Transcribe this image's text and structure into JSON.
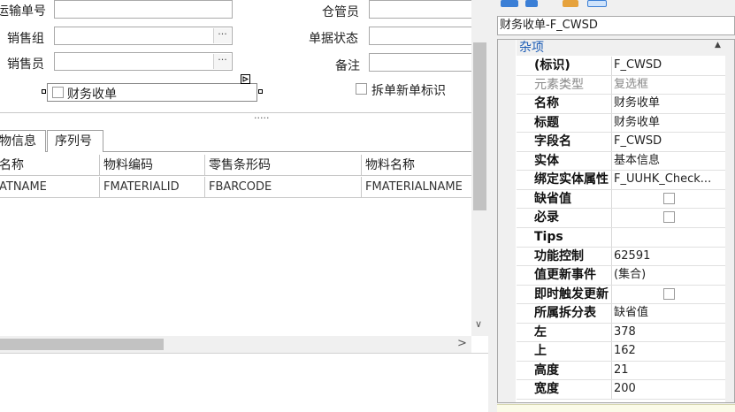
{
  "form": {
    "fields": [
      {
        "label": "运输单号",
        "value": ""
      },
      {
        "label": "销售组",
        "value": "",
        "button": "···"
      },
      {
        "label": "销售员",
        "value": "",
        "button": "···"
      },
      {
        "label": "仓管员",
        "value": ""
      },
      {
        "label": "单据状态",
        "value": ""
      },
      {
        "label": "备注",
        "value": ""
      }
    ],
    "selected_checkbox": {
      "label": "财务收单"
    },
    "split_checkbox": {
      "label": "拆单新单标识"
    },
    "splitter": "·····"
  },
  "tabs": [
    {
      "label": "物信息"
    },
    {
      "label": "序列号"
    }
  ],
  "table": {
    "headers": [
      "名称",
      "物料编码",
      "零售条形码",
      "物料名称"
    ],
    "rows": [
      [
        "ATNAME",
        "FMATERIALID",
        "FBARCODE",
        "FMATERIALNAME"
      ]
    ]
  },
  "scroll_arrows": {
    "down": "∨",
    "right": ">"
  },
  "properties": {
    "object_selector": "财务收单-F_CWSD",
    "category": "杂项",
    "collapse_glyph": "▲",
    "rows": [
      {
        "name": "(标识)",
        "value": "F_CWSD"
      },
      {
        "name": "元素类型",
        "value": "复选框",
        "disabled": true
      },
      {
        "name": "名称",
        "value": "财务收单"
      },
      {
        "name": "标题",
        "value": "财务收单"
      },
      {
        "name": "字段名",
        "value": "F_CWSD"
      },
      {
        "name": "实体",
        "value": "基本信息"
      },
      {
        "name": "绑定实体属性",
        "value": "F_UUHK_Check..."
      },
      {
        "name": "缺省值",
        "value": "",
        "checkbox": true
      },
      {
        "name": "必录",
        "value": "",
        "checkbox": true
      },
      {
        "name": "Tips",
        "value": ""
      },
      {
        "name": "功能控制",
        "value": "62591"
      },
      {
        "name": "值更新事件",
        "value": "(集合)"
      },
      {
        "name": "即时触发更新",
        "value": "",
        "checkbox": true
      },
      {
        "name": "所属拆分表",
        "value": "缺省值"
      },
      {
        "name": "左",
        "value": "378"
      },
      {
        "name": "上",
        "value": "162"
      },
      {
        "name": "高度",
        "value": "21"
      },
      {
        "name": "宽度",
        "value": "200"
      }
    ]
  },
  "colors": {
    "category_text": "#1a5bb5",
    "panel_bg": "#f0f0f0",
    "toolbar_blue": "#3b7fd6"
  }
}
